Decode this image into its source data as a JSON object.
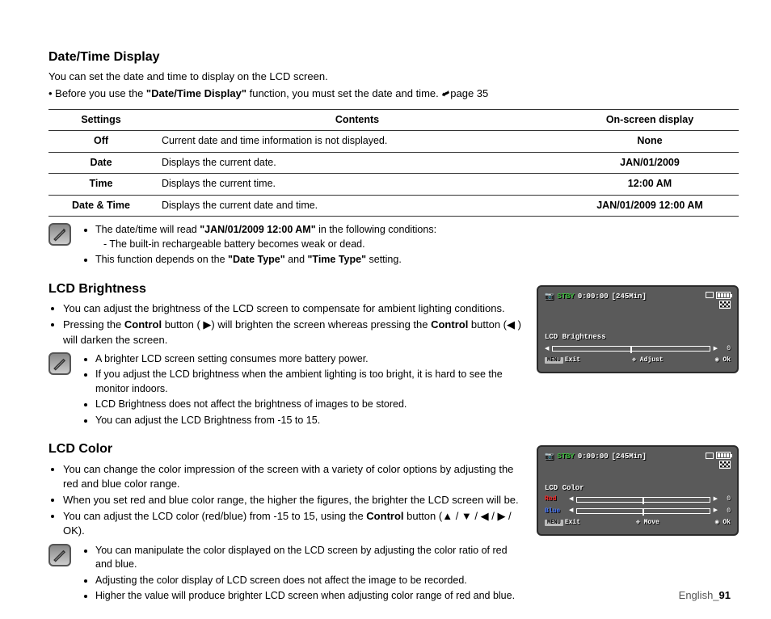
{
  "section1": {
    "title": "Date/Time Display",
    "intro": "You can set the date and time to display on the LCD screen.",
    "bullet_pre": "Before you use the ",
    "bullet_bold": "\"Date/Time Display\"",
    "bullet_post": " function, you must set the date and time. ",
    "bullet_page_ref": "page 35",
    "table": {
      "h1": "Settings",
      "h2": "Contents",
      "h3": "On-screen display",
      "rows": [
        {
          "c1": "Off",
          "c2": "Current date and time information is not displayed.",
          "c3": "None"
        },
        {
          "c1": "Date",
          "c2": "Displays the current date.",
          "c3": "JAN/01/2009"
        },
        {
          "c1": "Time",
          "c2": "Displays the current time.",
          "c3": "12:00 AM"
        },
        {
          "c1": "Date & Time",
          "c2": "Displays the current date and time.",
          "c3": "JAN/01/2009 12:00 AM"
        }
      ]
    },
    "notes": {
      "n1_pre": "The date/time will read ",
      "n1_bold": "\"JAN/01/2009 12:00 AM\"",
      "n1_post": " in the following conditions:",
      "n1_sub": "The built-in rechargeable battery becomes weak or dead.",
      "n2_pre": "This function depends on the ",
      "n2_bold1": "\"Date Type\"",
      "n2_mid": " and ",
      "n2_bold2": "\"Time Type\"",
      "n2_post": " setting."
    }
  },
  "section2": {
    "title": "LCD Brightness",
    "b1": "You can adjust the brightness of the LCD screen to compensate for ambient lighting conditions.",
    "b2_pre": "Pressing the ",
    "b2_bold1": "Control",
    "b2_mid1": " button ( ▶) will brighten the screen whereas pressing the ",
    "b2_bold2": "Control",
    "b2_mid2": " button (◀ ) will darken the screen.",
    "notes": [
      "A brighter LCD screen setting consumes more battery power.",
      "If you adjust the LCD brightness when the ambient lighting is too bright, it is hard to see the monitor indoors.",
      "LCD Brightness does not affect the brightness of images to be stored.",
      "You can adjust the LCD Brightness from -15 to 15."
    ]
  },
  "section3": {
    "title": "LCD Color",
    "b1": "You can change the color impression of the screen with a variety of color options by adjusting the red and blue color range.",
    "b2": "When you set red and blue color range, the higher the figures, the brighter the LCD screen will be.",
    "b3_pre": "You can adjust the LCD color (red/blue) from -15 to 15, using the ",
    "b3_bold": "Control",
    "b3_post": " button (▲ / ▼ / ◀ / ▶ / OK).",
    "notes": [
      "You can manipulate the color displayed on the LCD screen by adjusting the color ratio of red and blue.",
      "Adjusting the color display of LCD screen does not affect the image to be recorded.",
      "Higher the value will produce brighter LCD screen when adjusting color range of red and blue."
    ]
  },
  "lcd1": {
    "stby": "STBY",
    "time": "0:00:00",
    "remain": "[245Min]",
    "title": "LCD Brightness",
    "value": "0",
    "menu": "MENU",
    "exit": "Exit",
    "adjust": "Adjust",
    "ok": "Ok"
  },
  "lcd2": {
    "stby": "STBY",
    "time": "0:00:00",
    "remain": "[245Min]",
    "title": "LCD Color",
    "red_label": "Red",
    "blue_label": "Blue",
    "red_val": "0",
    "blue_val": "0",
    "menu": "MENU",
    "exit": "Exit",
    "move": "Move",
    "ok": "Ok"
  },
  "footer": {
    "lang": "English",
    "page": "91"
  }
}
